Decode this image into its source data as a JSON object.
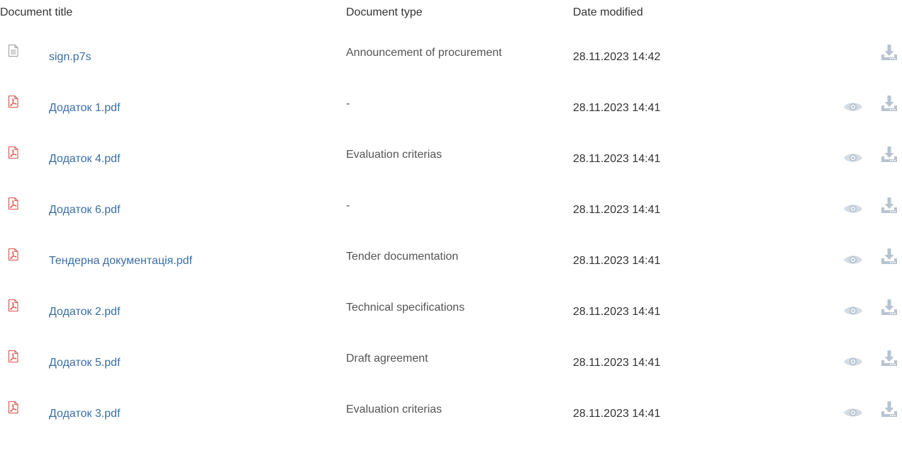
{
  "header": {
    "title_col": "Document title",
    "type_col": "Document type",
    "date_col": "Date modified"
  },
  "colors": {
    "link": "#3a6ea5",
    "pdf_icon": "#d9534f",
    "generic_icon": "#9a9a9a",
    "action_icon": "#b7c3d0"
  },
  "documents": [
    {
      "title": "sign.p7s",
      "type": "Announcement of procurement",
      "date": "28.11.2023 14:42",
      "icon": "file-text-icon",
      "preview": false
    },
    {
      "title": "Додаток 1.pdf",
      "type": "-",
      "date": "28.11.2023 14:41",
      "icon": "pdf-icon",
      "preview": true
    },
    {
      "title": "Додаток 4.pdf",
      "type": "Evaluation criterias",
      "date": "28.11.2023 14:41",
      "icon": "pdf-icon",
      "preview": true
    },
    {
      "title": "Додаток 6.pdf",
      "type": "-",
      "date": "28.11.2023 14:41",
      "icon": "pdf-icon",
      "preview": true
    },
    {
      "title": "Тендерна документація.pdf",
      "type": "Tender documentation",
      "date": "28.11.2023 14:41",
      "icon": "pdf-icon",
      "preview": true
    },
    {
      "title": "Додаток 2.pdf",
      "type": "Technical specifications",
      "date": "28.11.2023 14:41",
      "icon": "pdf-icon",
      "preview": true
    },
    {
      "title": "Додаток 5.pdf",
      "type": "Draft agreement",
      "date": "28.11.2023 14:41",
      "icon": "pdf-icon",
      "preview": true
    },
    {
      "title": "Додаток 3.pdf",
      "type": "Evaluation criterias",
      "date": "28.11.2023 14:41",
      "icon": "pdf-icon",
      "preview": true
    }
  ]
}
